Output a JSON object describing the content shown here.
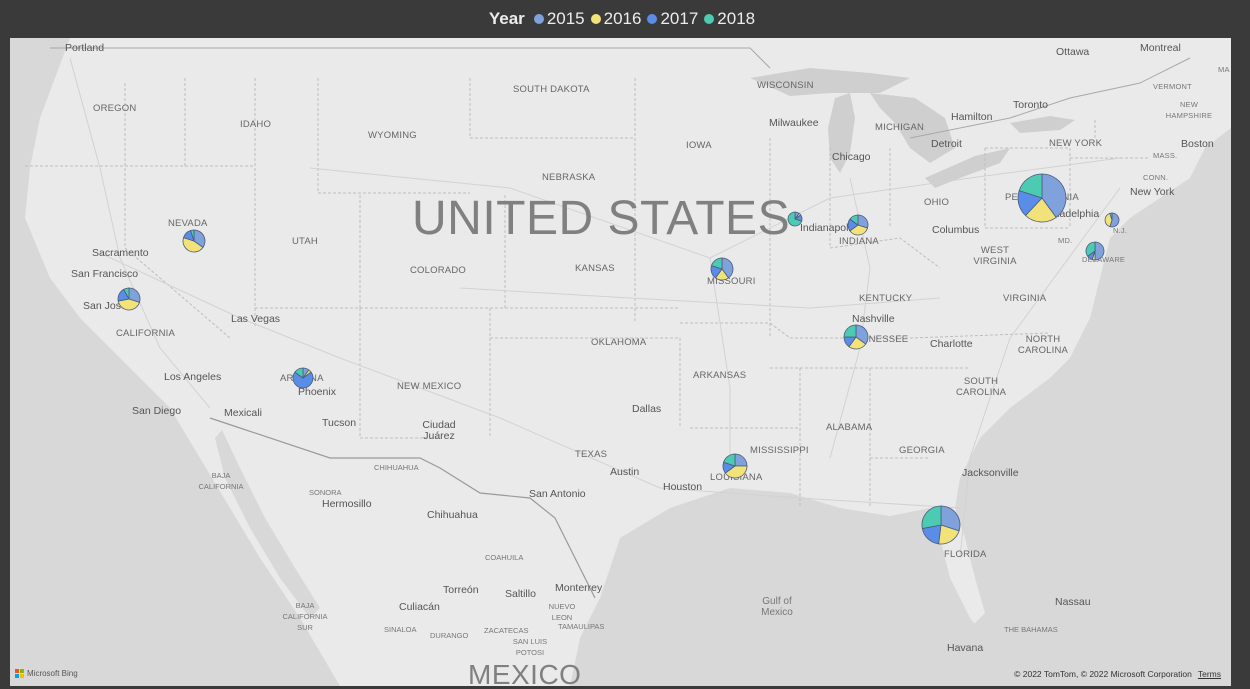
{
  "legend": {
    "title": "Year",
    "items": [
      {
        "label": "2015",
        "color": "#7fa2dc"
      },
      {
        "label": "2016",
        "color": "#f2e27a"
      },
      {
        "label": "2017",
        "color": "#5a8de8"
      },
      {
        "label": "2018",
        "color": "#4ccab2"
      }
    ]
  },
  "map": {
    "country_label": "UNITED STATES",
    "country_label_bottom": "MEXICO",
    "states": [
      "OREGON",
      "IDAHO",
      "WYOMING",
      "SOUTH DAKOTA",
      "WISCONSIN",
      "MICHIGAN",
      "NEW YORK",
      "VERMONT",
      "NEW HAMPSHIRE",
      "MASS.",
      "CONN.",
      "N.J.",
      "MD.",
      "DELAWARE",
      "NEVADA",
      "UTAH",
      "COLORADO",
      "NEBRASKA",
      "IOWA",
      "KANSAS",
      "MISSOURI",
      "INDIANA",
      "OHIO",
      "PENNSYLVANIA",
      "WEST VIRGINIA",
      "VIRGINIA",
      "KENTUCKY",
      "CALIFORNIA",
      "ARIZONA",
      "NEW MEXICO",
      "OKLAHOMA",
      "ARKANSAS",
      "TENNESSEE",
      "NORTH CAROLINA",
      "SOUTH CAROLINA",
      "TEXAS",
      "MISSISSIPPI",
      "ALABAMA",
      "GEORGIA",
      "LOUISIANA",
      "FLORIDA",
      "MA"
    ],
    "cities": [
      "Portland",
      "Ottawa",
      "Montreal",
      "Milwaukee",
      "Toronto",
      "Hamilton",
      "Boston",
      "Chicago",
      "Detroit",
      "New York",
      "Philadelphia",
      "Indianapolis",
      "Columbus",
      "Sacramento",
      "San Francisco",
      "San Jose",
      "Las Vegas",
      "Nashville",
      "Charlotte",
      "Los Angeles",
      "Phoenix",
      "San Diego",
      "Mexicali",
      "Tucson",
      "Ciudad Juárez",
      "Dallas",
      "Austin",
      "Houston",
      "San Antonio",
      "Jacksonville",
      "Hermosillo",
      "Chihuahua",
      "Torreón",
      "Saltillo",
      "Monterrey",
      "Culiacán",
      "Nassau",
      "Havana"
    ],
    "small_regions": [
      "BAJA CALIFORNIA",
      "SONORA",
      "CHIHUAHUA",
      "COAHUILA",
      "NUEVO LEON",
      "TAMAULIPAS",
      "ZACATECAS",
      "SAN LUIS POTOSI",
      "DURANGO",
      "SINALOA",
      "BAJA CALIFORNIA SUR",
      "THE BAHAMAS"
    ],
    "seas": [
      "Gulf of Mexico"
    ]
  },
  "chart_data": {
    "type": "pie",
    "title": "",
    "legend_title": "Year",
    "legend_position": "top",
    "series_names": [
      "2015",
      "2016",
      "2017",
      "2018"
    ],
    "pies": [
      {
        "location": "Pennsylvania",
        "values": [
          0.4,
          0.22,
          0.18,
          0.2
        ]
      },
      {
        "location": "Florida",
        "values": [
          0.3,
          0.22,
          0.2,
          0.28
        ]
      },
      {
        "location": "Nevada",
        "values": [
          0.35,
          0.45,
          0.15,
          0.05
        ]
      },
      {
        "location": "California",
        "values": [
          0.3,
          0.42,
          0.2,
          0.08
        ]
      },
      {
        "location": "Arizona",
        "values": [
          0.1,
          0.05,
          0.7,
          0.15
        ]
      },
      {
        "location": "Missouri",
        "values": [
          0.4,
          0.2,
          0.2,
          0.2
        ]
      },
      {
        "location": "Illinois",
        "values": [
          0.1,
          0.05,
          0.15,
          0.7
        ]
      },
      {
        "location": "Indiana",
        "values": [
          0.3,
          0.35,
          0.2,
          0.15
        ]
      },
      {
        "location": "Tennessee",
        "values": [
          0.35,
          0.25,
          0.15,
          0.25
        ]
      },
      {
        "location": "Louisiana",
        "values": [
          0.25,
          0.4,
          0.15,
          0.2
        ]
      },
      {
        "location": "New Jersey",
        "values": [
          0.55,
          0.4,
          0.0,
          0.05
        ]
      },
      {
        "location": "Delaware",
        "values": [
          0.5,
          0.05,
          0.1,
          0.35
        ]
      }
    ]
  },
  "attribution": {
    "logo_text": "Microsoft Bing",
    "copyright": "© 2022 TomTom, © 2022 Microsoft Corporation",
    "terms": "Terms"
  }
}
